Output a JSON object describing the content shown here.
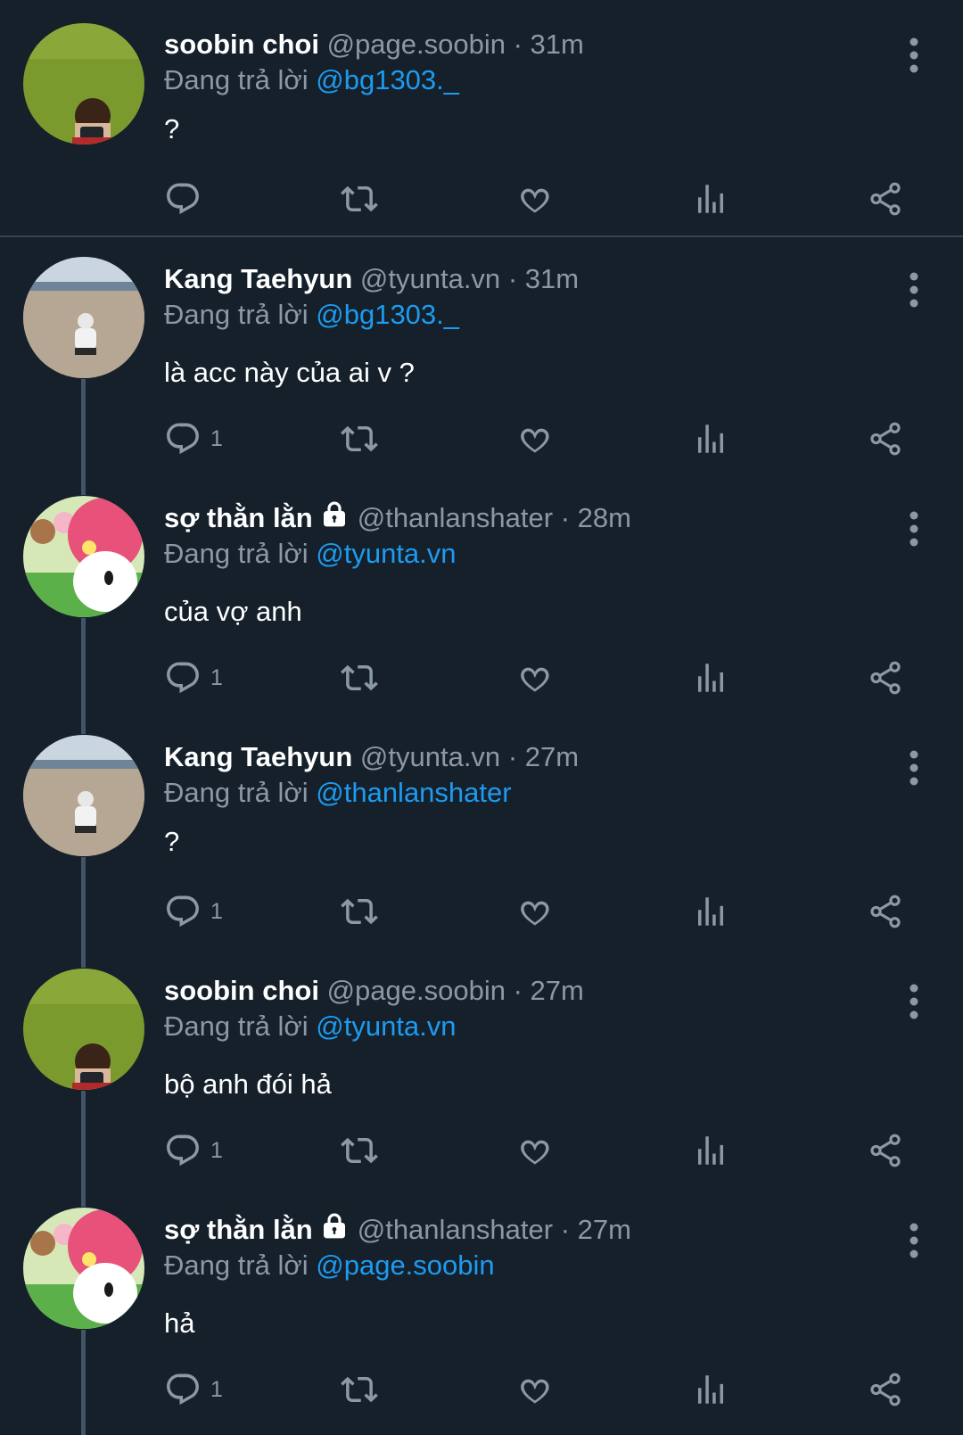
{
  "colors": {
    "background": "#15202b",
    "text": "#ffffff",
    "muted": "#8b98a5",
    "accent": "#1d9bf0",
    "icon": "#8b98a5",
    "divider": "#38444d",
    "thread_line": "#425466"
  },
  "icons": {
    "reply": "reply-icon",
    "retweet": "retweet-icon",
    "like": "heart-icon",
    "views": "views-icon",
    "share": "share-icon",
    "more": "more-vertical-icon",
    "lock": "lock-icon"
  },
  "tweets": [
    {
      "name": "soobin choi",
      "handle": "@page.soobin",
      "time": "· 31m",
      "reply_prefix": "Đang trả lời",
      "reply_to": "@bg1303._",
      "text": "?",
      "reply_count": "",
      "protected": false,
      "avatar": "green-grass"
    },
    {
      "name": "Kang Taehyun",
      "handle": "@tyunta.vn",
      "time": "· 31m",
      "reply_prefix": "Đang trả lời",
      "reply_to": "@bg1303._",
      "text": "là acc này của ai v ?",
      "reply_count": "1",
      "protected": false,
      "avatar": "beach"
    },
    {
      "name": "sợ thằn lằn",
      "handle": "@thanlanshater",
      "time": "· 28m",
      "reply_prefix": "Đang trả lời",
      "reply_to": "@tyunta.vn",
      "text": "của vợ anh",
      "reply_count": "1",
      "protected": true,
      "avatar": "cartoon"
    },
    {
      "name": "Kang Taehyun",
      "handle": "@tyunta.vn",
      "time": "· 27m",
      "reply_prefix": "Đang trả lời",
      "reply_to": "@thanlanshater",
      "text": "?",
      "reply_count": "1",
      "protected": false,
      "avatar": "beach"
    },
    {
      "name": "soobin choi",
      "handle": "@page.soobin",
      "time": "· 27m",
      "reply_prefix": "Đang trả lời",
      "reply_to": "@tyunta.vn",
      "text": "bộ anh đói hả",
      "reply_count": "1",
      "protected": false,
      "avatar": "green-grass"
    },
    {
      "name": "sợ thằn lằn",
      "handle": "@thanlanshater",
      "time": "· 27m",
      "reply_prefix": "Đang trả lời",
      "reply_to": "@page.soobin",
      "text": "hả",
      "reply_count": "1",
      "protected": true,
      "avatar": "cartoon"
    }
  ]
}
